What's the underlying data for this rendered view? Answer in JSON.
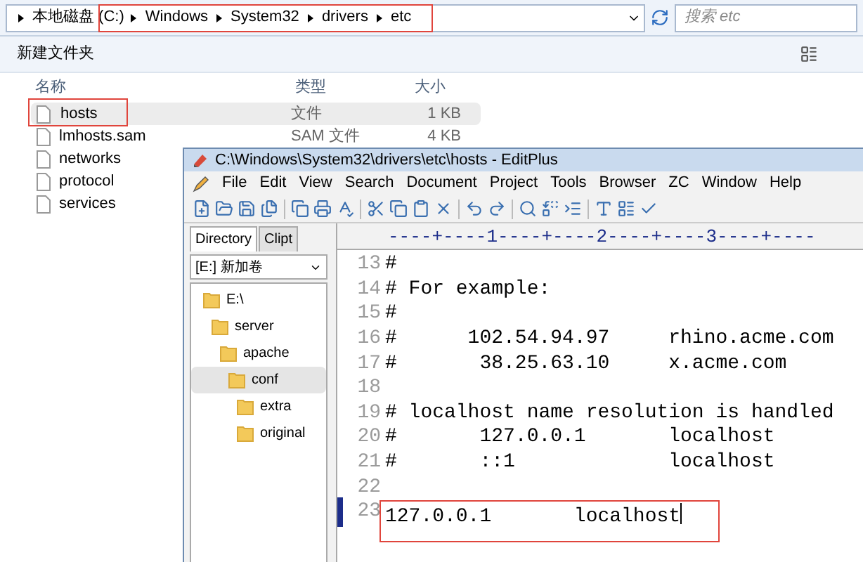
{
  "explorer": {
    "breadcrumb": [
      "本地磁盘 (C:)",
      "Windows",
      "System32",
      "drivers",
      "etc"
    ],
    "breadcrumb_highlighted": true,
    "search": {
      "placeholder": "搜索 etc"
    },
    "toolbar": {
      "new_folder": "新建文件夹"
    },
    "columns": [
      "名称",
      "类型",
      "大小"
    ],
    "files": [
      {
        "name": "hosts",
        "type": "文件",
        "size": "1 KB",
        "selected": true,
        "highlighted": true
      },
      {
        "name": "lmhosts.sam",
        "type": "SAM 文件",
        "size": "4 KB",
        "selected": false,
        "highlighted": false
      },
      {
        "name": "networks",
        "selected": false,
        "highlighted": false
      },
      {
        "name": "protocol",
        "selected": false,
        "highlighted": false
      },
      {
        "name": "services",
        "selected": false,
        "highlighted": false
      }
    ]
  },
  "editplus": {
    "title": "C:\\Windows\\System32\\drivers\\etc\\hosts - EditPlus",
    "menu": [
      "File",
      "Edit",
      "View",
      "Search",
      "Document",
      "Project",
      "Tools",
      "Browser",
      "ZC",
      "Window",
      "Help"
    ],
    "panel_tabs": [
      {
        "label": "Directory",
        "selected": true
      },
      {
        "label": "Clipt",
        "selected": false
      }
    ],
    "drive": "[E:] 新加卷",
    "tree": [
      {
        "label": "E:\\",
        "selected": false,
        "children": [
          {
            "label": "server",
            "selected": false,
            "children": [
              {
                "label": "apache",
                "selected": false,
                "children": [
                  {
                    "label": "conf",
                    "selected": true,
                    "children": [
                      {
                        "label": "extra",
                        "selected": false
                      },
                      {
                        "label": "original",
                        "selected": false
                      }
                    ]
                  }
                ]
              }
            ]
          }
        ]
      }
    ],
    "ruler": "----+----1----+----2----+----3----+----",
    "last_line_highlighted": true,
    "lines": [
      {
        "number": "13",
        "text": "#",
        "current": false
      },
      {
        "number": "14",
        "text": "# For example:",
        "current": false
      },
      {
        "number": "15",
        "text": "#",
        "current": false
      },
      {
        "number": "16",
        "text": "#      102.54.94.97     rhino.acme.com",
        "current": false
      },
      {
        "number": "17",
        "text": "#       38.25.63.10     x.acme.com",
        "current": false
      },
      {
        "number": "18",
        "current": false
      },
      {
        "number": "19",
        "text": "# localhost name resolution is handled",
        "current": false
      },
      {
        "number": "20",
        "text": "#       127.0.0.1       localhost",
        "current": false
      },
      {
        "number": "21",
        "text": "#       ::1             localhost",
        "current": false
      },
      {
        "number": "22",
        "current": false
      },
      {
        "number": "23",
        "text": "127.0.0.1       localhost",
        "current": true
      }
    ]
  }
}
